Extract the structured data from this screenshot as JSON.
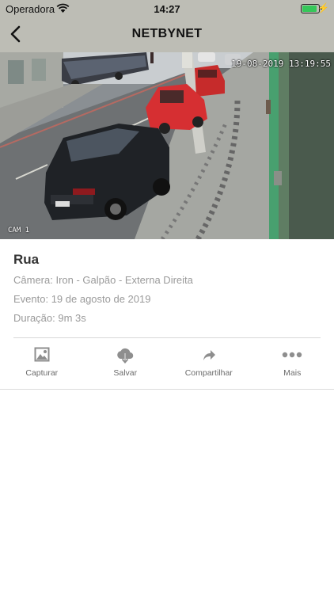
{
  "status_bar": {
    "carrier": "Operadora",
    "time": "14:27",
    "battery_level": 1.0,
    "battery_color": "#35c759"
  },
  "nav": {
    "title": "NETBYNET",
    "back_icon": "chevron-left-icon"
  },
  "video": {
    "timestamp": "19-08-2019 13:19:55",
    "camera_label": "CAM 1"
  },
  "event": {
    "title": "Rua",
    "camera": "Câmera: Iron - Galpão - Externa Direita",
    "event": "Evento: 19 de agosto de 2019",
    "duration": "Duração: 9m 3s"
  },
  "actions": [
    {
      "label": "Capturar",
      "icon": "image-icon"
    },
    {
      "label": "Salvar",
      "icon": "cloud-download-icon"
    },
    {
      "label": "Compartilhar",
      "icon": "share-icon"
    },
    {
      "label": "Mais",
      "icon": "more-dots-icon"
    }
  ],
  "colors": {
    "header_bg": "#bdbdb5",
    "icon_gray": "#8e8e8e",
    "muted_text": "#9a9a9a"
  }
}
